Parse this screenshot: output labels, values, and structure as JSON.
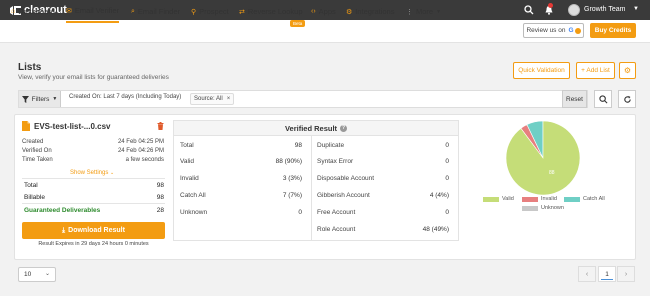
{
  "app": {
    "logo_text": "clearout",
    "team_name": "Growth Team"
  },
  "nav": {
    "items": [
      {
        "label": "Dashboard",
        "icon": "dashboard-icon"
      },
      {
        "label": "Email Verifier",
        "icon": "envelope-icon"
      },
      {
        "label": "Email Finder",
        "icon": "search-icon"
      },
      {
        "label": "Prospect",
        "icon": "user-search-icon"
      },
      {
        "label": "Reverse Lookup",
        "icon": "reverse-icon"
      },
      {
        "label": "Apps",
        "icon": "code-icon"
      },
      {
        "label": "Integrations",
        "icon": "integrations-icon"
      },
      {
        "label": "More"
      }
    ],
    "beta_label": "Beta",
    "review_label": "Review us on",
    "buy_label": "Buy Credits"
  },
  "page": {
    "title": "Lists",
    "subtitle": "View, verify your email lists for guaranteed deliveries",
    "quick_validation": "Quick Validation",
    "add_list": "+ Add List"
  },
  "filters": {
    "label": "Filters",
    "created_on": "Created On: Last 7 days (Including Today)",
    "source": "Source: All",
    "reset": "Reset"
  },
  "list": {
    "file_name": "EVS-test-list-...0.csv",
    "meta": [
      {
        "label": "Created",
        "value": "24 Feb 04:25 PM"
      },
      {
        "label": "Verified On",
        "value": "24 Feb 04:26 PM"
      },
      {
        "label": "Time Taken",
        "value": "a few seconds"
      }
    ],
    "show_settings": "Show Settings",
    "stats": [
      {
        "label": "Total",
        "value": "98"
      },
      {
        "label": "Billable",
        "value": "98"
      },
      {
        "label": "Guaranteed Deliverables",
        "value": "28"
      }
    ],
    "download_label": "Download Result",
    "expires": "Result Expires in 29 days 24 hours 0 minutes"
  },
  "verified_result": {
    "title": "Verified Result",
    "left": [
      {
        "label": "Total",
        "value": "98"
      },
      {
        "label": "Valid",
        "value": "88 (90%)"
      },
      {
        "label": "Invalid",
        "value": "3 (3%)"
      },
      {
        "label": "Catch All",
        "value": "7 (7%)"
      },
      {
        "label": "Unknown",
        "value": "0"
      }
    ],
    "right": [
      {
        "label": "Duplicate",
        "value": "0"
      },
      {
        "label": "Syntax Error",
        "value": "0"
      },
      {
        "label": "Disposable Account",
        "value": "0"
      },
      {
        "label": "Gibberish Account",
        "value": "4 (4%)"
      },
      {
        "label": "Free Account",
        "value": "0"
      },
      {
        "label": "Role Account",
        "value": "48 (49%)"
      }
    ]
  },
  "chart_data": {
    "type": "pie",
    "categories": [
      "Valid",
      "Invalid",
      "Catch All",
      "Unknown"
    ],
    "values": [
      88,
      3,
      7,
      0
    ],
    "colors": [
      "#c5dd78",
      "#e77f7f",
      "#6fcfc5",
      "#c8c8c8"
    ],
    "slice_label": "88",
    "legend": "bottom"
  },
  "pagination": {
    "page_size": "10",
    "current_page": "1"
  },
  "colors": {
    "accent": "#f39c12",
    "topbar": "#3a3a3a"
  }
}
